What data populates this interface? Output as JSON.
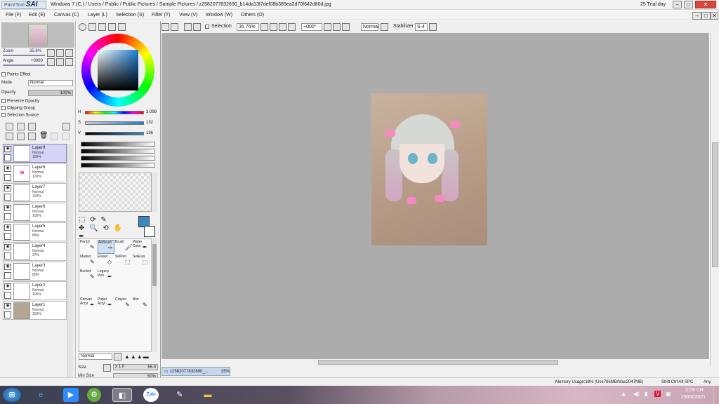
{
  "window": {
    "app_logo_small": "PaintTool",
    "app_logo_big": "SAI",
    "title": "Windows 7 (C:) / Users / Public / Public Pictures / Sample Pictures / z2582077832690_b14da13f7def08b385ea2d70f642d80d.jpg",
    "trial": "25 Trial day"
  },
  "menu": [
    "File (F)",
    "Edit (E)",
    "Canvas (C)",
    "Layer (L)",
    "Selection (S)",
    "Filter (T)",
    "View (V)",
    "Window (W)",
    "Others (O)"
  ],
  "toolbar": {
    "selection_label": "Selection",
    "zoom_value": "35.76%",
    "rotation_value": "+000°",
    "blend_mode": "Normal",
    "stabilizer_label": "Stabilizer",
    "stabilizer_value": "S-4"
  },
  "navigator": {
    "zoom_label": "Zoom",
    "zoom_value": "35.8%",
    "angle_label": "Angle",
    "angle_value": "+0000"
  },
  "layer_props": {
    "paint_effect": "Paints Effect",
    "mode_label": "Mode",
    "mode_value": "Normal",
    "opacity_label": "Opacity",
    "opacity_value": "100%",
    "preserve_opacity": "Preserve Opacity",
    "clipping_group": "Clipping Group",
    "selection_source": "Selection Source"
  },
  "layers": [
    {
      "name": "Layer9",
      "mode": "Normal",
      "opacity": "100%",
      "selected": true
    },
    {
      "name": "Layer8",
      "mode": "Normal",
      "opacity": "100%"
    },
    {
      "name": "Layer7",
      "mode": "Normal",
      "opacity": "100%"
    },
    {
      "name": "Layer6",
      "mode": "Normal",
      "opacity": "100%"
    },
    {
      "name": "Layer5",
      "mode": "Normal",
      "opacity": "89%"
    },
    {
      "name": "Layer4",
      "mode": "Normal",
      "opacity": "37%"
    },
    {
      "name": "Layer3",
      "mode": "Normal",
      "opacity": "80%"
    },
    {
      "name": "Layer2",
      "mode": "Normal",
      "opacity": "100%"
    },
    {
      "name": "Layer1",
      "mode": "Normal",
      "opacity": "100%"
    }
  ],
  "color": {
    "h_label": "H",
    "h_value": "3.099",
    "s_label": "S",
    "s_value": "132",
    "v_label": "V",
    "v_value": "186",
    "current_color": "#3a87c0"
  },
  "tools": [
    {
      "label": "Pencil"
    },
    {
      "label": "AirBrush",
      "selected": true
    },
    {
      "label": "Brush"
    },
    {
      "label": "Water Color"
    },
    {
      "label": "Marker"
    },
    {
      "label": "Eraser"
    },
    {
      "label": "SelPen"
    },
    {
      "label": "SelEras"
    },
    {
      "label": "Bucket"
    },
    {
      "label": "Legacy Pen"
    },
    {
      "label": "Canvas Acryl"
    },
    {
      "label": "Paper Acryl"
    },
    {
      "label": "Crayon"
    },
    {
      "label": "Blur"
    }
  ],
  "brush": {
    "mode": "Normal",
    "size_label": "Size",
    "size_mult": "x 1.0",
    "size_value": "55.0",
    "min_size_label": "Min Size",
    "min_size_value": "50%"
  },
  "doc_tab": {
    "name": "z2582077832690_...",
    "zoom": "35%"
  },
  "status": {
    "memory": "Memory Usage:38% (Use786MB/Max2047MB)",
    "keys": "Shift Ctrl Alt SPC",
    "any": "Any"
  },
  "taskbar": {
    "time": "5:09 CH",
    "date": "29/06/2021",
    "zalo_label": "Zalo"
  }
}
